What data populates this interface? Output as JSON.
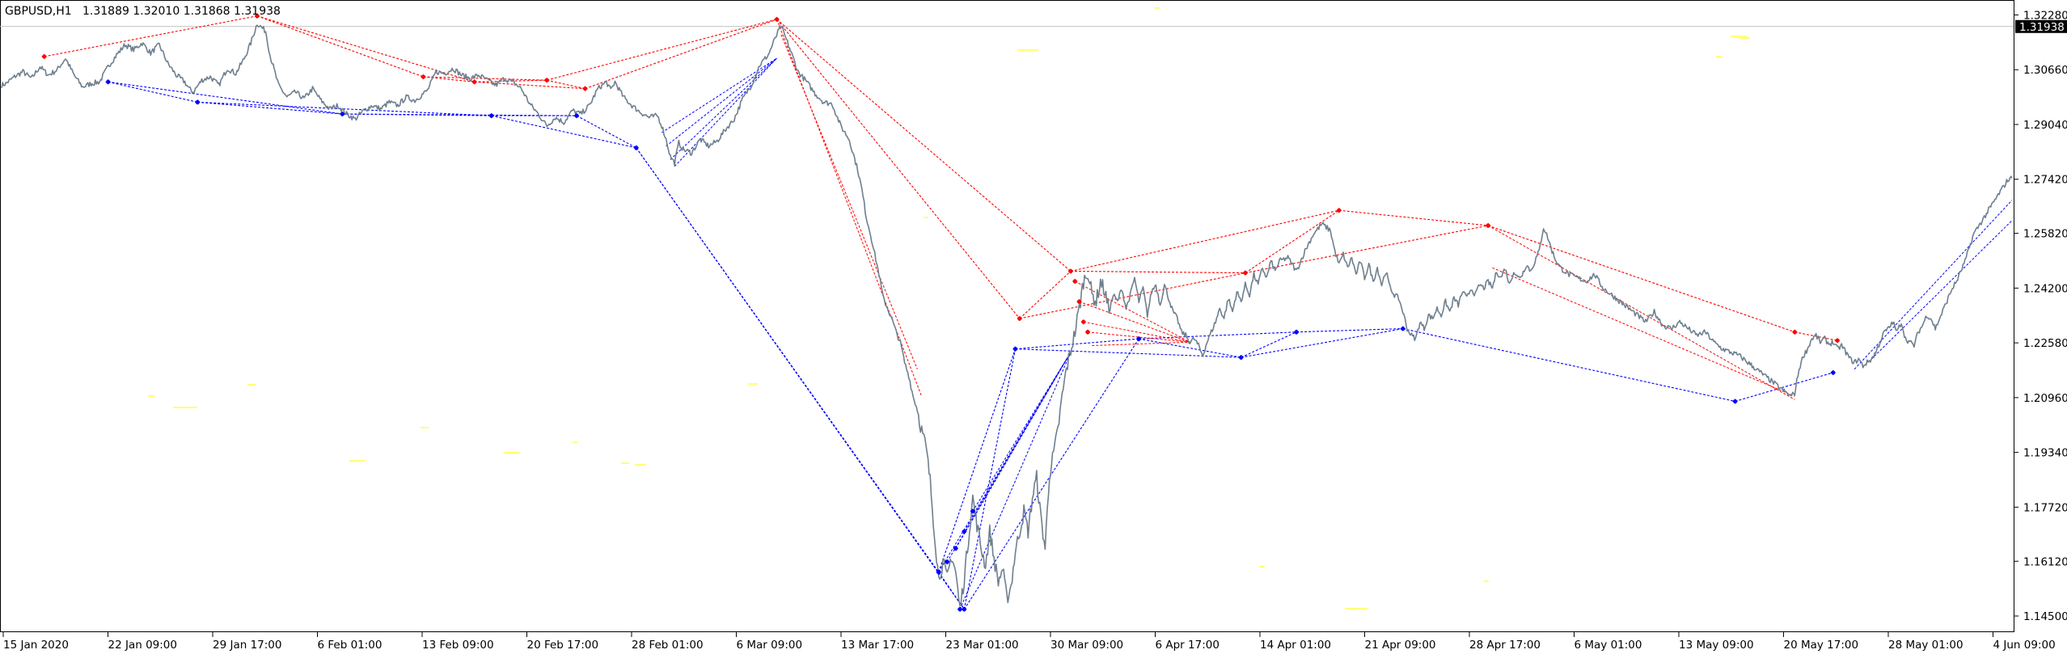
{
  "header": {
    "symbol": "GBPUSD,H1",
    "ohlc": "1.31889 1.32010 1.31868 1.31938"
  },
  "price_axis": {
    "ticks": [
      "1.32280",
      "1.30660",
      "1.29040",
      "1.27420",
      "1.25820",
      "1.24200",
      "1.22580",
      "1.20960",
      "1.19340",
      "1.17720",
      "1.16120",
      "1.14500"
    ],
    "current_price": "1.31938"
  },
  "time_axis": {
    "ticks": [
      "15 Jan 2020",
      "22 Jan 09:00",
      "29 Jan 17:00",
      "6 Feb 01:00",
      "13 Feb 09:00",
      "20 Feb 17:00",
      "28 Feb 01:00",
      "6 Mar 09:00",
      "13 Mar 17:00",
      "23 Mar 01:00",
      "30 Mar 09:00",
      "6 Apr 17:00",
      "14 Apr 01:00",
      "21 Apr 09:00",
      "28 Apr 17:00",
      "6 May 01:00",
      "13 May 09:00",
      "20 May 17:00",
      "28 May 01:00",
      "4 Jun 09:00"
    ]
  },
  "colors": {
    "price_line": "#6e7f8e",
    "high_marker": "#ff0000",
    "low_marker": "#0000ff",
    "high_link": "#ff0000",
    "low_link": "#0000ff",
    "stray_dots": "#ffff66",
    "current_tag_bg": "#000000",
    "current_tag_fg": "#ffffff",
    "grid": "#c0c0c0"
  },
  "chart_data": {
    "type": "line",
    "symbol": "GBPUSD",
    "timeframe": "H1",
    "ylim": [
      1.1402,
      1.3282
    ],
    "x_range": [
      "15 Jan 2020",
      "6 Jun 2020"
    ],
    "grid": false,
    "anchors": [
      [
        0,
        1.302
      ],
      [
        2,
        1.3025
      ],
      [
        6,
        1.3045
      ],
      [
        10,
        1.306
      ],
      [
        14,
        1.304
      ],
      [
        18,
        1.3075
      ],
      [
        22,
        1.305
      ],
      [
        26,
        1.3065
      ],
      [
        30,
        1.31
      ],
      [
        34,
        1.305
      ],
      [
        38,
        1.3015
      ],
      [
        42,
        1.3025
      ],
      [
        46,
        1.303
      ],
      [
        50,
        1.3075
      ],
      [
        54,
        1.311
      ],
      [
        58,
        1.314
      ],
      [
        62,
        1.3125
      ],
      [
        66,
        1.3145
      ],
      [
        70,
        1.3115
      ],
      [
        74,
        1.314
      ],
      [
        78,
        1.3085
      ],
      [
        82,
        1.305
      ],
      [
        86,
        1.303
      ],
      [
        88,
        1.301
      ],
      [
        90,
        1.3
      ],
      [
        94,
        1.3035
      ],
      [
        98,
        1.3045
      ],
      [
        102,
        1.302
      ],
      [
        106,
        1.307
      ],
      [
        110,
        1.3055
      ],
      [
        114,
        1.31
      ],
      [
        117,
        1.3145
      ],
      [
        120,
        1.3203
      ],
      [
        124,
        1.318
      ],
      [
        126,
        1.311
      ],
      [
        130,
        1.302
      ],
      [
        134,
        1.2985
      ],
      [
        138,
        1.3
      ],
      [
        142,
        1.298
      ],
      [
        146,
        1.301
      ],
      [
        150,
        1.2975
      ],
      [
        154,
        1.295
      ],
      [
        158,
        1.296
      ],
      [
        162,
        1.2935
      ],
      [
        166,
        1.292
      ],
      [
        170,
        1.2945
      ],
      [
        174,
        1.296
      ],
      [
        178,
        1.295
      ],
      [
        182,
        1.297
      ],
      [
        186,
        1.296
      ],
      [
        190,
        1.2985
      ],
      [
        194,
        1.2975
      ],
      [
        198,
        1.2995
      ],
      [
        200,
        1.3005
      ],
      [
        204,
        1.306
      ],
      [
        208,
        1.3055
      ],
      [
        212,
        1.307
      ],
      [
        216,
        1.305
      ],
      [
        220,
        1.304
      ],
      [
        224,
        1.305
      ],
      [
        228,
        1.3035
      ],
      [
        232,
        1.302
      ],
      [
        236,
        1.304
      ],
      [
        240,
        1.303
      ],
      [
        244,
        1.301
      ],
      [
        248,
        1.2965
      ],
      [
        252,
        1.2935
      ],
      [
        256,
        1.29
      ],
      [
        260,
        1.2925
      ],
      [
        264,
        1.291
      ],
      [
        268,
        1.2945
      ],
      [
        272,
        1.2935
      ],
      [
        276,
        1.296
      ],
      [
        280,
        1.301
      ],
      [
        284,
        1.303
      ],
      [
        286,
        1.3005
      ],
      [
        288,
        1.303
      ],
      [
        292,
        1.2985
      ],
      [
        296,
        1.296
      ],
      [
        300,
        1.294
      ],
      [
        304,
        1.2925
      ],
      [
        308,
        1.293
      ],
      [
        310,
        1.29
      ],
      [
        312,
        1.286
      ],
      [
        314,
        1.281
      ],
      [
        316,
        1.279
      ],
      [
        318,
        1.285
      ],
      [
        320,
        1.283
      ],
      [
        324,
        1.282
      ],
      [
        328,
        1.286
      ],
      [
        332,
        1.284
      ],
      [
        336,
        1.2855
      ],
      [
        340,
        1.289
      ],
      [
        344,
        1.292
      ],
      [
        348,
        1.298
      ],
      [
        352,
        1.302
      ],
      [
        356,
        1.308
      ],
      [
        360,
        1.311
      ],
      [
        364,
        1.317
      ],
      [
        366,
        1.3195
      ],
      [
        370,
        1.313
      ],
      [
        374,
        1.306
      ],
      [
        378,
        1.303
      ],
      [
        382,
        1.2995
      ],
      [
        386,
        1.297
      ],
      [
        390,
        1.2965
      ],
      [
        394,
        1.29
      ],
      [
        398,
        1.286
      ],
      [
        402,
        1.277
      ],
      [
        404,
        1.271
      ],
      [
        406,
        1.263
      ],
      [
        408,
        1.258
      ],
      [
        410,
        1.252
      ],
      [
        412,
        1.246
      ],
      [
        414,
        1.239
      ],
      [
        416,
        1.236
      ],
      [
        418,
        1.233
      ],
      [
        420,
        1.229
      ],
      [
        422,
        1.226
      ],
      [
        424,
        1.22
      ],
      [
        426,
        1.216
      ],
      [
        428,
        1.21
      ],
      [
        430,
        1.206
      ],
      [
        432,
        1.2
      ],
      [
        434,
        1.195
      ],
      [
        436,
        1.185
      ],
      [
        438,
        1.17
      ],
      [
        440,
        1.156
      ],
      [
        442,
        1.161
      ],
      [
        444,
        1.156
      ],
      [
        446,
        1.163
      ],
      [
        448,
        1.158
      ],
      [
        450,
        1.147
      ],
      [
        452,
        1.156
      ],
      [
        454,
        1.168
      ],
      [
        456,
        1.18
      ],
      [
        458,
        1.172
      ],
      [
        460,
        1.165
      ],
      [
        462,
        1.16
      ],
      [
        464,
        1.17
      ],
      [
        466,
        1.162
      ],
      [
        468,
        1.155
      ],
      [
        470,
        1.159
      ],
      [
        472,
        1.15
      ],
      [
        474,
        1.154
      ],
      [
        476,
        1.164
      ],
      [
        478,
        1.17
      ],
      [
        480,
        1.176
      ],
      [
        482,
        1.17
      ],
      [
        484,
        1.18
      ],
      [
        486,
        1.186
      ],
      [
        488,
        1.174
      ],
      [
        490,
        1.165
      ],
      [
        492,
        1.187
      ],
      [
        494,
        1.193
      ],
      [
        496,
        1.2
      ],
      [
        498,
        1.21
      ],
      [
        500,
        1.218
      ],
      [
        504,
        1.229
      ],
      [
        506,
        1.236
      ],
      [
        508,
        1.244
      ],
      [
        510,
        1.247
      ],
      [
        512,
        1.24
      ],
      [
        514,
        1.238
      ],
      [
        516,
        1.244
      ],
      [
        518,
        1.241
      ],
      [
        520,
        1.235
      ],
      [
        522,
        1.24
      ],
      [
        524,
        1.238
      ],
      [
        526,
        1.242
      ],
      [
        528,
        1.236
      ],
      [
        530,
        1.24
      ],
      [
        532,
        1.245
      ],
      [
        534,
        1.238
      ],
      [
        536,
        1.242
      ],
      [
        538,
        1.234
      ],
      [
        540,
        1.241
      ],
      [
        542,
        1.243
      ],
      [
        544,
        1.237
      ],
      [
        546,
        1.243
      ],
      [
        548,
        1.239
      ],
      [
        550,
        1.235
      ],
      [
        552,
        1.233
      ],
      [
        554,
        1.229
      ],
      [
        556,
        1.228
      ],
      [
        558,
        1.226
      ],
      [
        560,
        1.227
      ],
      [
        562,
        1.225
      ],
      [
        564,
        1.222
      ],
      [
        566,
        1.226
      ],
      [
        568,
        1.229
      ],
      [
        570,
        1.232
      ],
      [
        572,
        1.236
      ],
      [
        574,
        1.233
      ],
      [
        576,
        1.239
      ],
      [
        578,
        1.235
      ],
      [
        580,
        1.241
      ],
      [
        582,
        1.238
      ],
      [
        584,
        1.243
      ],
      [
        586,
        1.24
      ],
      [
        588,
        1.246
      ],
      [
        590,
        1.243
      ],
      [
        592,
        1.248
      ],
      [
        594,
        1.245
      ],
      [
        596,
        1.25
      ],
      [
        598,
        1.247
      ],
      [
        600,
        1.25
      ],
      [
        604,
        1.251
      ],
      [
        608,
        1.247
      ],
      [
        612,
        1.253
      ],
      [
        616,
        1.258
      ],
      [
        620,
        1.261
      ],
      [
        624,
        1.259
      ],
      [
        626,
        1.253
      ],
      [
        628,
        1.249
      ],
      [
        630,
        1.252
      ],
      [
        632,
        1.248
      ],
      [
        634,
        1.251
      ],
      [
        636,
        1.246
      ],
      [
        638,
        1.25
      ],
      [
        640,
        1.245
      ],
      [
        642,
        1.249
      ],
      [
        644,
        1.244
      ],
      [
        646,
        1.248
      ],
      [
        648,
        1.243
      ],
      [
        650,
        1.247
      ],
      [
        652,
        1.242
      ],
      [
        654,
        1.24
      ],
      [
        656,
        1.239
      ],
      [
        658,
        1.235
      ],
      [
        660,
        1.23
      ],
      [
        662,
        1.228
      ],
      [
        664,
        1.227
      ],
      [
        666,
        1.232
      ],
      [
        668,
        1.23
      ],
      [
        670,
        1.234
      ],
      [
        672,
        1.233
      ],
      [
        674,
        1.236
      ],
      [
        676,
        1.234
      ],
      [
        678,
        1.238
      ],
      [
        680,
        1.235
      ],
      [
        682,
        1.239
      ],
      [
        684,
        1.237
      ],
      [
        686,
        1.241
      ],
      [
        688,
        1.239
      ],
      [
        690,
        1.242
      ],
      [
        692,
        1.24
      ],
      [
        694,
        1.243
      ],
      [
        696,
        1.242
      ],
      [
        698,
        1.244
      ],
      [
        700,
        1.242
      ],
      [
        702,
        1.247
      ],
      [
        704,
        1.245
      ],
      [
        706,
        1.248
      ],
      [
        708,
        1.243
      ],
      [
        710,
        1.247
      ],
      [
        712,
        1.245
      ],
      [
        714,
        1.246
      ],
      [
        716,
        1.249
      ],
      [
        718,
        1.247
      ],
      [
        720,
        1.25
      ],
      [
        722,
        1.253
      ],
      [
        724,
        1.26
      ],
      [
        726,
        1.257
      ],
      [
        728,
        1.253
      ],
      [
        730,
        1.25
      ],
      [
        732,
        1.248
      ],
      [
        736,
        1.246
      ],
      [
        740,
        1.245
      ],
      [
        744,
        1.244
      ],
      [
        748,
        1.246
      ],
      [
        752,
        1.242
      ],
      [
        756,
        1.24
      ],
      [
        760,
        1.238
      ],
      [
        764,
        1.236
      ],
      [
        768,
        1.234
      ],
      [
        772,
        1.232
      ],
      [
        776,
        1.235
      ],
      [
        780,
        1.231
      ],
      [
        784,
        1.23
      ],
      [
        788,
        1.232
      ],
      [
        792,
        1.23
      ],
      [
        796,
        1.228
      ],
      [
        800,
        1.229
      ],
      [
        804,
        1.226
      ],
      [
        808,
        1.224
      ],
      [
        812,
        1.223
      ],
      [
        816,
        1.222
      ],
      [
        820,
        1.22
      ],
      [
        824,
        1.218
      ],
      [
        828,
        1.216
      ],
      [
        832,
        1.214
      ],
      [
        836,
        1.212
      ],
      [
        840,
        1.21
      ],
      [
        842,
        1.211
      ],
      [
        844,
        1.218
      ],
      [
        846,
        1.222
      ],
      [
        848,
        1.224
      ],
      [
        850,
        1.227
      ],
      [
        852,
        1.228
      ],
      [
        854,
        1.226
      ],
      [
        856,
        1.227
      ],
      [
        858,
        1.2255
      ],
      [
        860,
        1.226
      ],
      [
        862,
        1.224
      ],
      [
        864,
        1.225
      ],
      [
        866,
        1.223
      ],
      [
        868,
        1.221
      ],
      [
        870,
        1.22
      ],
      [
        872,
        1.221
      ],
      [
        874,
        1.219
      ],
      [
        876,
        1.22
      ],
      [
        878,
        1.221
      ],
      [
        880,
        1.223
      ],
      [
        882,
        1.226
      ],
      [
        884,
        1.229
      ],
      [
        886,
        1.23
      ],
      [
        888,
        1.232
      ],
      [
        890,
        1.229
      ],
      [
        892,
        1.232
      ],
      [
        894,
        1.227
      ],
      [
        896,
        1.226
      ],
      [
        898,
        1.225
      ],
      [
        900,
        1.229
      ],
      [
        902,
        1.231
      ],
      [
        904,
        1.234
      ],
      [
        906,
        1.233
      ],
      [
        908,
        1.23
      ],
      [
        910,
        1.233
      ],
      [
        912,
        1.236
      ],
      [
        914,
        1.239
      ],
      [
        916,
        1.242
      ],
      [
        918,
        1.244
      ],
      [
        920,
        1.247
      ],
      [
        922,
        1.25
      ],
      [
        924,
        1.254
      ],
      [
        926,
        1.258
      ],
      [
        928,
        1.26
      ],
      [
        930,
        1.262
      ],
      [
        932,
        1.264
      ],
      [
        934,
        1.266
      ],
      [
        936,
        1.268
      ],
      [
        938,
        1.27
      ],
      [
        940,
        1.272
      ],
      [
        942,
        1.274
      ],
      [
        944,
        1.2745
      ]
    ],
    "x_anchor_units": "hours after 15 Jan 2020 00:00 (approximate)",
    "swing_highs": [
      [
        20,
        1.3105
      ],
      [
        120,
        1.3225
      ],
      [
        198,
        1.3045
      ],
      [
        222,
        1.303
      ],
      [
        256,
        1.3035
      ],
      [
        274,
        1.301
      ],
      [
        364,
        1.3215
      ],
      [
        478,
        1.233
      ],
      [
        502,
        1.247
      ],
      [
        584,
        1.2465
      ],
      [
        628,
        1.265
      ],
      [
        698,
        1.2605
      ],
      [
        842,
        1.229
      ],
      [
        862,
        1.2265
      ]
    ],
    "swing_lows": [
      [
        50,
        1.303
      ],
      [
        92,
        1.297
      ],
      [
        160,
        1.2935
      ],
      [
        230,
        1.293
      ],
      [
        270,
        1.293
      ],
      [
        298,
        1.2835
      ],
      [
        440,
        1.158
      ],
      [
        452,
        1.147
      ],
      [
        476,
        1.224
      ],
      [
        534,
        1.227
      ],
      [
        582,
        1.2215
      ],
      [
        608,
        1.229
      ],
      [
        658,
        1.23
      ],
      [
        814,
        1.2085
      ],
      [
        860,
        1.217
      ]
    ]
  }
}
